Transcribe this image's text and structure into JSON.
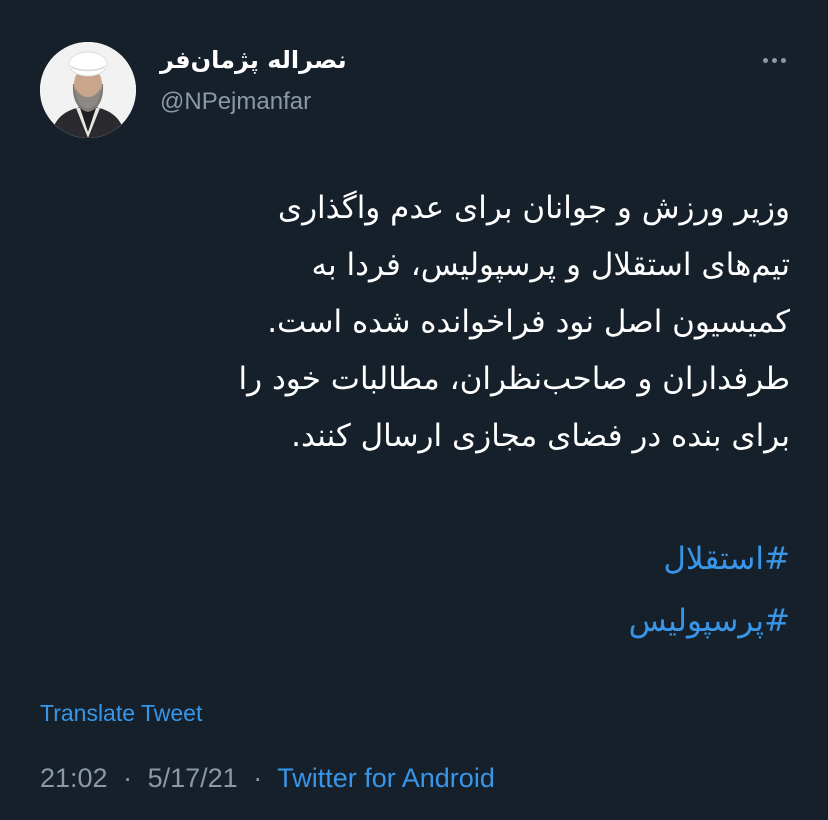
{
  "author": {
    "name": "نصراله پژمان‌فر",
    "handle": "@NPejmanfar"
  },
  "tweet": {
    "lines": [
      "وزیر ورزش و جوانان برای عدم واگذاری",
      "تیم‌های استقلال و پرسپولیس، فردا به",
      "کمیسیون اصل نود فراخوانده شده است.",
      "طرفداران و صاحب‌نظران، مطالبات خود را",
      "برای بنده در فضای مجازی ارسال کنند."
    ],
    "hashtags": [
      "#استقلال",
      "#پرسپولیس"
    ]
  },
  "translate_label": "Translate Tweet",
  "meta": {
    "time": "21:02",
    "separator": "·",
    "date": "5/17/21",
    "source": "Twitter for Android"
  },
  "icons": {
    "more": "more-horizontal-icon"
  },
  "colors": {
    "background": "#16202b",
    "text": "#ffffff",
    "secondary": "#8b98a5",
    "link": "#3796e8"
  }
}
